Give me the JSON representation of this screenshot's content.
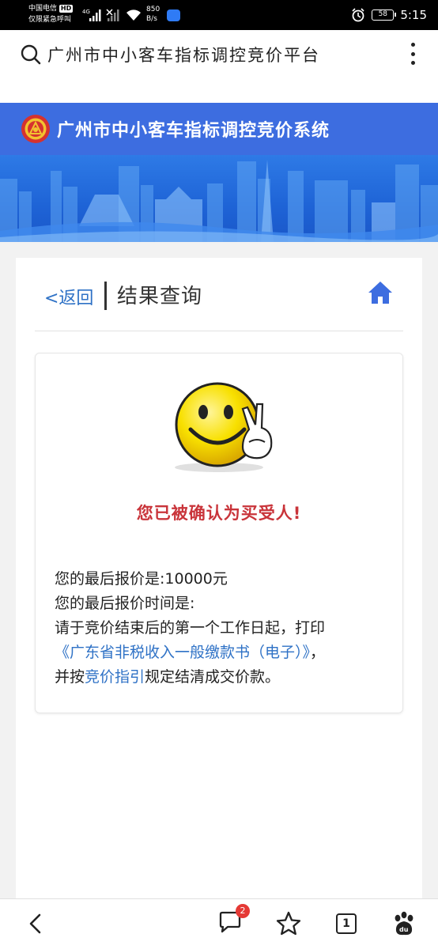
{
  "status_bar": {
    "carrier_line1": "中国电信",
    "carrier_hd": "HD",
    "carrier_line2": "仅限紧急呼叫",
    "net_type": "4G",
    "net_speed_value": "850",
    "net_speed_unit": "B/s",
    "battery": "58",
    "time": "5:15"
  },
  "browser": {
    "url_title": "广州市中小客车指标调控竞价平台"
  },
  "site": {
    "title": "广州市中小客车指标调控竞价系统"
  },
  "page": {
    "back_label": "<返回",
    "title": "结果查询"
  },
  "result": {
    "heading": "您已被确认为买受人!",
    "final_price_label": "您的最后报价是:",
    "final_price_value": "10000元",
    "final_time_label": "您的最后报价时间是:",
    "instruction_part1": "请于竞价结束后的第一个工作日起，打印",
    "payment_doc_link": "《广东省非税收入一般缴款书（电子）》",
    "instruction_part2": "，",
    "instruction_part3": "并按",
    "guide_link": "竞价指引",
    "instruction_part4": "规定结清成交价款。"
  },
  "bottom_nav": {
    "messages_badge": "2",
    "tab_count": "1"
  },
  "colors": {
    "header_blue": "#3d6de0",
    "link_blue": "#2f72c6",
    "heading_red": "#c9343a"
  },
  "icons": [
    "search-icon",
    "more-vert-icon",
    "home-icon",
    "back-arrow-icon",
    "message-icon",
    "star-icon",
    "tabs-icon",
    "baidu-paw-icon"
  ]
}
